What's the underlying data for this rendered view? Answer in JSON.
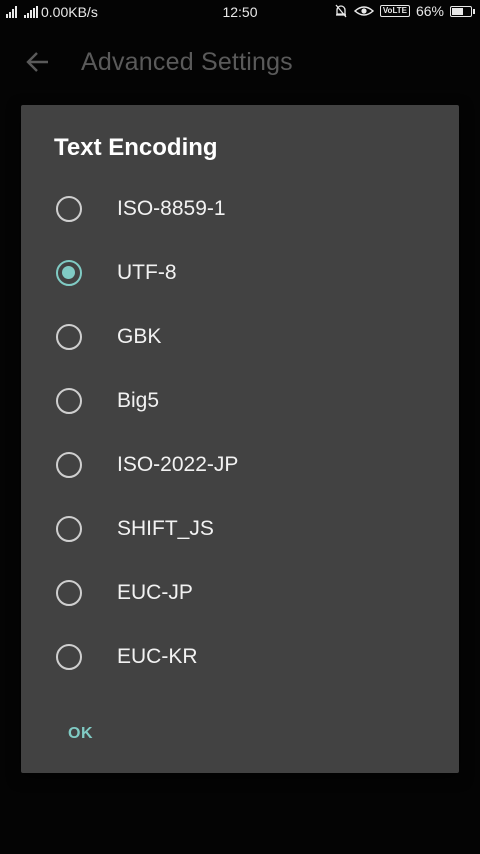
{
  "status_bar": {
    "network_speed": "0.00KB/s",
    "time": "12:50",
    "volte": "VoLTE",
    "battery_percent": "66%",
    "battery_level": 0.66
  },
  "app_bar": {
    "title": "Advanced Settings",
    "back_icon": "arrow-back-icon"
  },
  "dialog": {
    "title": "Text Encoding",
    "options": [
      {
        "label": "ISO-8859-1",
        "checked": false
      },
      {
        "label": "UTF-8",
        "checked": true
      },
      {
        "label": "GBK",
        "checked": false
      },
      {
        "label": "Big5",
        "checked": false
      },
      {
        "label": "ISO-2022-JP",
        "checked": false
      },
      {
        "label": "SHIFT_JS",
        "checked": false
      },
      {
        "label": "EUC-JP",
        "checked": false
      },
      {
        "label": "EUC-KR",
        "checked": false
      }
    ],
    "ok_label": "OK"
  },
  "colors": {
    "accent": "#80cbc4",
    "dialog_bg": "#424242",
    "background": "#040404"
  }
}
